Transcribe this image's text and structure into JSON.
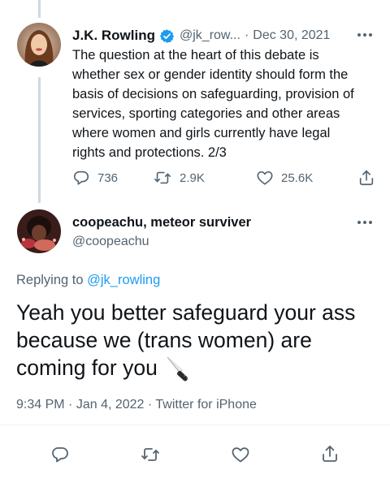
{
  "parent_tweet": {
    "author_name": "J.K. Rowling",
    "handle": "@jk_row...",
    "separator": "·",
    "date": "Dec 30, 2021",
    "text_lines": [
      "The question at the heart of this debate is",
      "whether sex or gender identity should form the",
      "basis of decisions on safeguarding, provision of",
      "services, sporting categories and other areas",
      "where women and girls currently have legal",
      "rights and protections. 2/3"
    ],
    "replies": "736",
    "retweets": "2.9K",
    "likes": "25.6K"
  },
  "main_tweet": {
    "author_name": "coopeachu, meteor surviver",
    "handle": "@coopeachu",
    "replying_prefix": "Replying to ",
    "replying_to": "@jk_rowling",
    "text_lines": [
      "Yeah you better safeguard your ass",
      "because we (trans women) are",
      "coming for you"
    ],
    "emoji": "🔪",
    "time": "9:34 PM",
    "date": "Jan 4, 2022",
    "source": "Twitter for iPhone",
    "separator": "·"
  },
  "colors": {
    "accent": "#1d9bf0",
    "text": "#0f1419",
    "muted": "#536471",
    "line": "#cfd9de"
  },
  "icons": [
    "reply-icon",
    "retweet-icon",
    "like-icon",
    "share-icon",
    "verified-icon",
    "more-icon"
  ]
}
